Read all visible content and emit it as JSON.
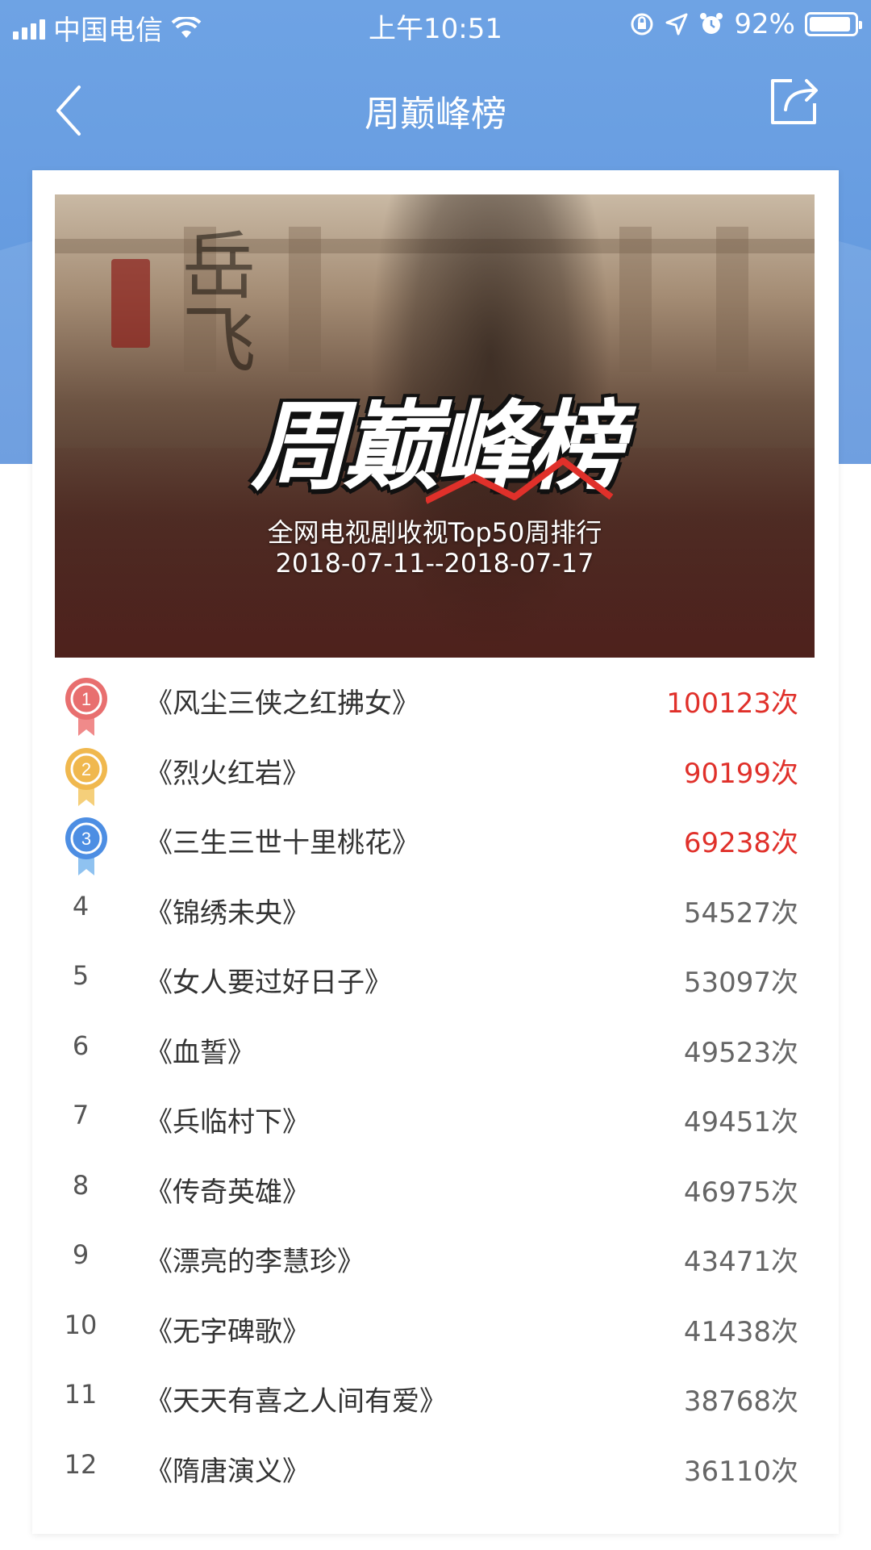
{
  "status_bar": {
    "carrier": "中国电信",
    "time": "上午10:51",
    "battery": "92%"
  },
  "nav": {
    "title": "周巅峰榜"
  },
  "banner": {
    "logo": "周巅峰榜",
    "subtitle": "全网电视剧收视Top50周排行",
    "date_range": "2018-07-11--2018-07-17"
  },
  "colors": {
    "header_blue": "#6a9fe2",
    "top_count_red": "#e0302a",
    "medal_1": "#e86f6f",
    "medal_2": "#f0b84e",
    "medal_3": "#4d8ee3"
  },
  "rankings": [
    {
      "rank": "1",
      "name": "《风尘三侠之红拂女》",
      "count": "100123次"
    },
    {
      "rank": "2",
      "name": "《烈火红岩》",
      "count": "90199次"
    },
    {
      "rank": "3",
      "name": "《三生三世十里桃花》",
      "count": "69238次"
    },
    {
      "rank": "4",
      "name": "《锦绣未央》",
      "count": "54527次"
    },
    {
      "rank": "5",
      "name": "《女人要过好日子》",
      "count": "53097次"
    },
    {
      "rank": "6",
      "name": "《血誓》",
      "count": "49523次"
    },
    {
      "rank": "7",
      "name": "《兵临村下》",
      "count": "49451次"
    },
    {
      "rank": "8",
      "name": "《传奇英雄》",
      "count": "46975次"
    },
    {
      "rank": "9",
      "name": "《漂亮的李慧珍》",
      "count": "43471次"
    },
    {
      "rank": "10",
      "name": "《无字碑歌》",
      "count": "41438次"
    },
    {
      "rank": "11",
      "name": "《天天有喜之人间有爱》",
      "count": "38768次"
    },
    {
      "rank": "12",
      "name": "《隋唐演义》",
      "count": "36110次"
    }
  ]
}
